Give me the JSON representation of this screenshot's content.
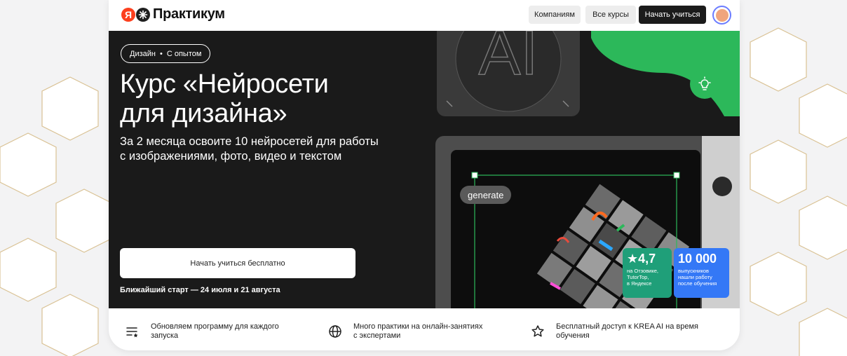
{
  "header": {
    "logo_letter": "Я",
    "logo_text": "Практикум",
    "nav": [
      {
        "label": "Компаниям"
      },
      {
        "label": "Все курсы"
      }
    ],
    "cta_label": "Начать учиться"
  },
  "hero": {
    "tag_category": "Дизайн",
    "tag_separator": "•",
    "tag_level": "С опытом",
    "title_line1": "Курс «Нейросети",
    "title_line2": "для дизайна»",
    "subtitle_line1": "За 2 месяца освоите 10 нейросетей для работы",
    "subtitle_line2": "с изображениями, фото, видео и текстом",
    "cta_label": "Начать учиться бесплатно",
    "start_text": "Ближайший старт — 24 июля и 21 августа",
    "art_letters": "AI",
    "generate_label": "generate",
    "rating": {
      "value": "★4,7",
      "line1": "на Отзовике,",
      "line2": "TutorTop,",
      "line3": "в Яндексе"
    },
    "graduates": {
      "value": "10 000",
      "line1": "выпускников",
      "line2": "нашли работу",
      "line3": "после обучения"
    }
  },
  "features": [
    {
      "icon": "list-star-icon",
      "line1": "Обновляем программу для каждого",
      "line2": "запуска"
    },
    {
      "icon": "globe-icon",
      "line1": "Много практики на онлайн-занятиях",
      "line2": "с экспертами"
    },
    {
      "icon": "star-outline-icon",
      "line1": "Бесплатный доступ к KREA AI на время",
      "line2": "обучения"
    }
  ],
  "colors": {
    "brand_red": "#fc3f1d",
    "hero_bg": "#1a1a1a",
    "rating_green": "#1f9f79",
    "graduates_blue": "#3478f6",
    "accent_green": "#2cb85a"
  }
}
